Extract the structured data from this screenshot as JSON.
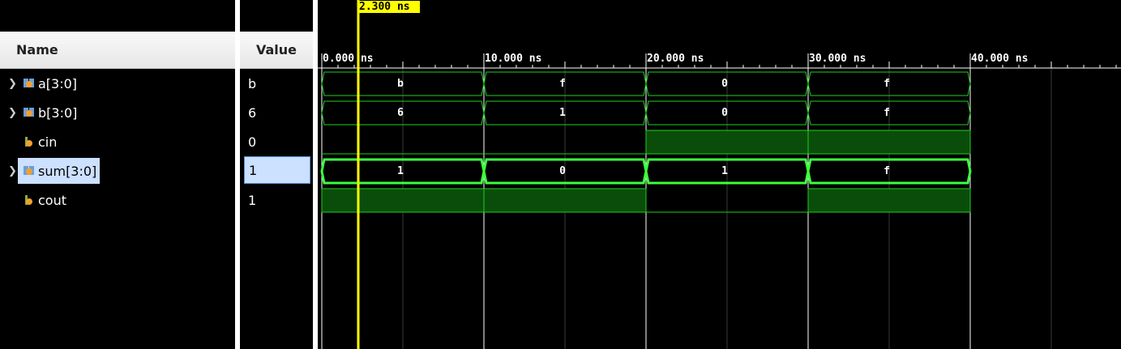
{
  "columns": {
    "name": "Name",
    "value": "Value"
  },
  "cursor": {
    "label": "2.300 ns"
  },
  "timeline": {
    "ticks": [
      "0.000 ns",
      "10.000 ns",
      "20.000 ns",
      "30.000 ns",
      "40.000 ns"
    ]
  },
  "signals": [
    {
      "name": "a[3:0]",
      "value": "b",
      "kind": "bus",
      "expandable": true,
      "segments": [
        "b",
        "f",
        "0",
        "f"
      ]
    },
    {
      "name": "b[3:0]",
      "value": "6",
      "kind": "bus",
      "expandable": true,
      "segments": [
        "6",
        "1",
        "0",
        "f"
      ]
    },
    {
      "name": "cin",
      "value": "0",
      "kind": "bit",
      "expandable": false,
      "levels": [
        0,
        0,
        1,
        1
      ]
    },
    {
      "name": "sum[3:0]",
      "value": "1",
      "kind": "bus",
      "expandable": true,
      "selected": true,
      "segments": [
        "1",
        "0",
        "1",
        "f"
      ]
    },
    {
      "name": "cout",
      "value": "1",
      "kind": "bit",
      "expandable": false,
      "levels": [
        1,
        1,
        0,
        1
      ]
    }
  ],
  "colors": {
    "wave": "#1ed01e",
    "wave_highlight": "#3dff3d",
    "high_fill": "#0a4d0a",
    "cursor": "#ffff00",
    "grid": "#3a3a3a",
    "selection": "#cce0ff"
  }
}
